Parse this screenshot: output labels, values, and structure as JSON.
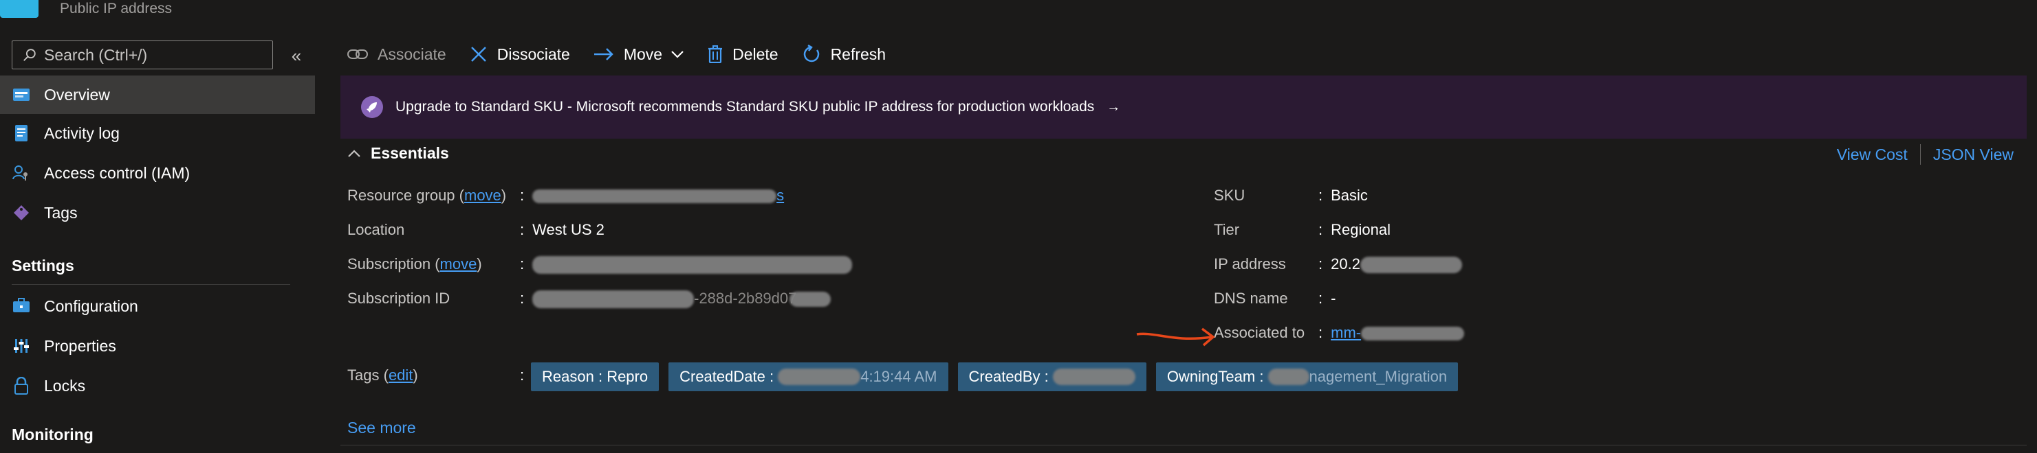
{
  "header": {
    "subtitle": "Public IP address"
  },
  "sidebar": {
    "search_placeholder": "Search (Ctrl+/)",
    "collapse_glyph": "«",
    "items": [
      {
        "label": "Overview",
        "icon": "overview-icon"
      },
      {
        "label": "Activity log",
        "icon": "activity-log-icon"
      },
      {
        "label": "Access control (IAM)",
        "icon": "iam-icon"
      },
      {
        "label": "Tags",
        "icon": "tag-icon"
      }
    ],
    "sections": [
      {
        "title": "Settings",
        "items": [
          {
            "label": "Configuration",
            "icon": "configuration-icon"
          },
          {
            "label": "Properties",
            "icon": "properties-icon"
          },
          {
            "label": "Locks",
            "icon": "lock-icon"
          }
        ]
      },
      {
        "title": "Monitoring"
      }
    ]
  },
  "toolbar": {
    "associate": "Associate",
    "dissociate": "Dissociate",
    "move": "Move",
    "delete": "Delete",
    "refresh": "Refresh"
  },
  "banner": {
    "text": "Upgrade to Standard SKU - Microsoft recommends Standard SKU public IP address for production workloads",
    "arrow": "→"
  },
  "essentials": {
    "title": "Essentials",
    "view_cost": "View Cost",
    "json_view": "JSON View",
    "left": {
      "resource_group": {
        "label": "Resource group",
        "action": "move",
        "value_suffix": "s"
      },
      "location": {
        "label": "Location",
        "value": "West US 2"
      },
      "subscription": {
        "label": "Subscription",
        "action": "move"
      },
      "subscription_id": {
        "label": "Subscription ID",
        "value_suffix": "-288d-2b89d07"
      }
    },
    "right": {
      "sku": {
        "label": "SKU",
        "value": "Basic"
      },
      "tier": {
        "label": "Tier",
        "value": "Regional"
      },
      "ip_address": {
        "label": "IP address",
        "value_prefix": "20.2"
      },
      "dns_name": {
        "label": "DNS name",
        "value": "-"
      },
      "associated_to": {
        "label": "Associated to",
        "value_prefix": "mm-"
      }
    },
    "tags": {
      "label": "Tags",
      "action": "edit",
      "items": [
        {
          "key": "Reason",
          "value": "Repro"
        },
        {
          "key": "CreatedDate",
          "value_suffix": "4:19:44 AM"
        },
        {
          "key": "CreatedBy"
        },
        {
          "key": "OwningTeam",
          "value_suffix": "nagement_Migration"
        }
      ]
    },
    "see_more": "See more"
  },
  "colors": {
    "background": "#1b1a19",
    "link": "#479ef5",
    "banner": "#2b1a33",
    "tag": "#2d5a7b",
    "annotation_arrow": "#e8471a"
  }
}
